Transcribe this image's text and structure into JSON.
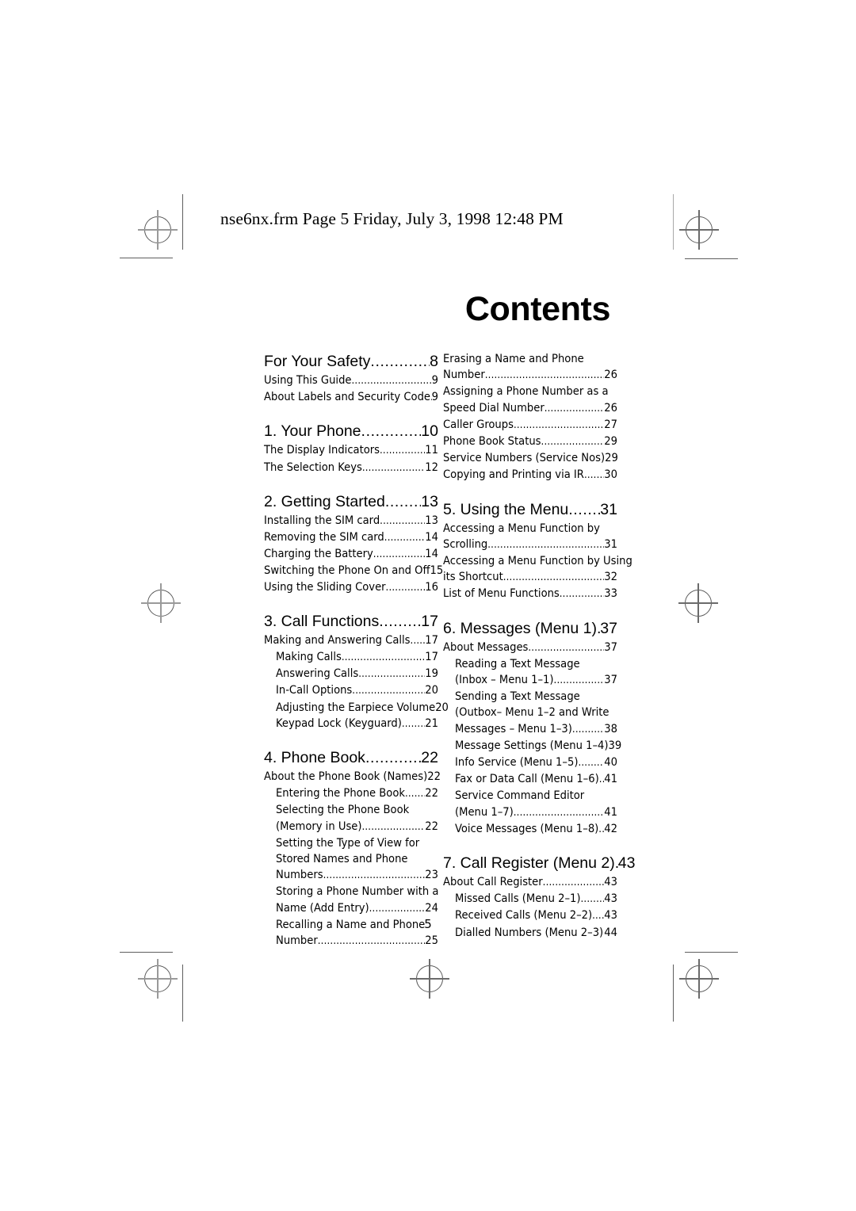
{
  "header": {
    "file_line": "nse6nx.frm  Page 5  Friday, July 3, 1998  12:48 PM"
  },
  "title": "Contents",
  "folio": "5",
  "dot_leader": "..........................................................................",
  "columns": {
    "left": [
      {
        "kind": "chapter",
        "title": "For Your Safety ",
        "page": "8"
      },
      {
        "kind": "entry",
        "level": 1,
        "title": "Using This Guide ",
        "page": "9"
      },
      {
        "kind": "entry",
        "level": 1,
        "title": "About Labels and Security Code ",
        "page": "9",
        "dots": "..."
      },
      {
        "kind": "chapter",
        "title": "1. Your Phone ",
        "page": "10"
      },
      {
        "kind": "entry",
        "level": 1,
        "title": "The Display Indicators ",
        "page": "11"
      },
      {
        "kind": "entry",
        "level": 1,
        "title": "The Selection Keys ",
        "page": "12"
      },
      {
        "kind": "chapter",
        "title": "2. Getting Started",
        "page": "13"
      },
      {
        "kind": "entry",
        "level": 1,
        "title": "Installing the SIM card ",
        "page": "13"
      },
      {
        "kind": "entry",
        "level": 1,
        "title": "Removing the SIM card ",
        "page": "14"
      },
      {
        "kind": "entry",
        "level": 1,
        "title": "Charging the Battery ",
        "page": "14"
      },
      {
        "kind": "entry",
        "level": 1,
        "title": "Switching the Phone On and Off",
        "page": "15",
        "nodots": true
      },
      {
        "kind": "entry",
        "level": 1,
        "title": "Using the Sliding Cover ",
        "page": "16"
      },
      {
        "kind": "chapter",
        "title": "3. Call Functions",
        "page": "17"
      },
      {
        "kind": "entry",
        "level": 1,
        "title": "Making and Answering Calls ",
        "page": "17"
      },
      {
        "kind": "entry",
        "level": 2,
        "title": "Making Calls",
        "page": "17"
      },
      {
        "kind": "entry",
        "level": 2,
        "title": "Answering Calls",
        "page": "19"
      },
      {
        "kind": "entry",
        "level": 2,
        "title": "In-Call Options ",
        "page": "20"
      },
      {
        "kind": "entry",
        "level": 2,
        "title": "Adjusting the Earpiece Volume",
        "page": "20",
        "nodots": true
      },
      {
        "kind": "entry",
        "level": 2,
        "title": "Keypad Lock (Keyguard)",
        "page": "21"
      },
      {
        "kind": "chapter",
        "title": "4. Phone Book",
        "page": "22"
      },
      {
        "kind": "entry",
        "level": 1,
        "title": "About the Phone Book (Names)",
        "page": "22",
        "dots": "."
      },
      {
        "kind": "entry",
        "level": 2,
        "title": "Entering the Phone Book",
        "page": "22"
      },
      {
        "kind": "entry",
        "level": 2,
        "title": "Selecting the Phone Book",
        "page": "",
        "nodots": true
      },
      {
        "kind": "entry",
        "level": 2,
        "title": "(Memory in Use)",
        "page": "22"
      },
      {
        "kind": "entry",
        "level": 2,
        "title": "Setting the Type of View for",
        "page": "",
        "nodots": true
      },
      {
        "kind": "entry",
        "level": 2,
        "title": "Stored Names and Phone",
        "page": "",
        "nodots": true
      },
      {
        "kind": "entry",
        "level": 2,
        "title": "Numbers",
        "page": "23"
      },
      {
        "kind": "entry",
        "level": 2,
        "title": "Storing a Phone Number with a",
        "page": "",
        "nodots": true
      },
      {
        "kind": "entry",
        "level": 2,
        "title": "Name (Add Entry) ",
        "page": "24"
      },
      {
        "kind": "entry",
        "level": 2,
        "title": "Recalling a Name and Phone",
        "page": "",
        "nodots": true
      },
      {
        "kind": "entry",
        "level": 2,
        "title": "Number",
        "page": "25"
      }
    ],
    "right": [
      {
        "kind": "entry",
        "level": 1,
        "title": "Erasing a Name and Phone",
        "page": "",
        "nodots": true
      },
      {
        "kind": "entry",
        "level": 1,
        "title": "Number ",
        "page": "26"
      },
      {
        "kind": "entry",
        "level": 1,
        "title": "Assigning a Phone Number as a",
        "page": "",
        "nodots": true
      },
      {
        "kind": "entry",
        "level": 1,
        "title": "Speed Dial Number",
        "page": "26"
      },
      {
        "kind": "entry",
        "level": 1,
        "title": "Caller Groups",
        "page": "27"
      },
      {
        "kind": "entry",
        "level": 1,
        "title": "Phone Book Status",
        "page": "29"
      },
      {
        "kind": "entry",
        "level": 1,
        "title": "Service Numbers (Service Nos)",
        "page": "29",
        "dots": "."
      },
      {
        "kind": "entry",
        "level": 1,
        "title": "Copying and Printing via IR ",
        "page": "30"
      },
      {
        "kind": "chapter",
        "title": "5. Using the Menu",
        "page": "31"
      },
      {
        "kind": "entry",
        "level": 1,
        "title": "Accessing a Menu Function by",
        "page": "",
        "nodots": true
      },
      {
        "kind": "entry",
        "level": 1,
        "title": "Scrolling ",
        "page": "31"
      },
      {
        "kind": "entry",
        "level": 1,
        "title": "Accessing a Menu Function by Using",
        "page": "",
        "nodots": true
      },
      {
        "kind": "entry",
        "level": 1,
        "title": "its Shortcut ",
        "page": "32"
      },
      {
        "kind": "entry",
        "level": 1,
        "title": "List of Menu Functions ",
        "page": "33"
      },
      {
        "kind": "chapter",
        "title": "6. Messages (Menu 1)",
        "page": "37"
      },
      {
        "kind": "entry",
        "level": 1,
        "title": "About Messages ",
        "page": "37"
      },
      {
        "kind": "entry",
        "level": 2,
        "title": "Reading a Text Message",
        "page": "",
        "nodots": true
      },
      {
        "kind": "entry",
        "level": 2,
        "title": "(Inbox – Menu 1–1)",
        "page": "37"
      },
      {
        "kind": "entry",
        "level": 2,
        "title": "Sending a Text Message",
        "page": "",
        "nodots": true
      },
      {
        "kind": "entry",
        "level": 2,
        "title": "(Outbox– Menu 1–2 and Write",
        "page": "",
        "nodots": true
      },
      {
        "kind": "entry",
        "level": 2,
        "title": "Messages – Menu 1–3) ",
        "page": "38"
      },
      {
        "kind": "entry",
        "level": 2,
        "title": "Message Settings (Menu 1–4)",
        "page": "39",
        "dots": ".."
      },
      {
        "kind": "entry",
        "level": 2,
        "title": "Info Service (Menu 1–5)",
        "page": "40"
      },
      {
        "kind": "entry",
        "level": 2,
        "title": "Fax or Data Call (Menu 1–6)",
        "page": "41"
      },
      {
        "kind": "entry",
        "level": 2,
        "title": "Service Command Editor",
        "page": "",
        "nodots": true
      },
      {
        "kind": "entry",
        "level": 2,
        "title": "(Menu 1–7)",
        "page": "41"
      },
      {
        "kind": "entry",
        "level": 2,
        "title": "Voice Messages (Menu 1–8)",
        "page": "42"
      },
      {
        "kind": "chapter",
        "title": "7. Call Register (Menu 2)",
        "page": "43",
        "dots": ".."
      },
      {
        "kind": "entry",
        "level": 1,
        "title": "About Call Register ",
        "page": "43"
      },
      {
        "kind": "entry",
        "level": 2,
        "title": "Missed Calls (Menu 2–1)",
        "page": "43"
      },
      {
        "kind": "entry",
        "level": 2,
        "title": "Received Calls (Menu 2–2) ",
        "page": "43"
      },
      {
        "kind": "entry",
        "level": 2,
        "title": "Dialled Numbers (Menu 2–3)",
        "page": "44"
      }
    ]
  }
}
